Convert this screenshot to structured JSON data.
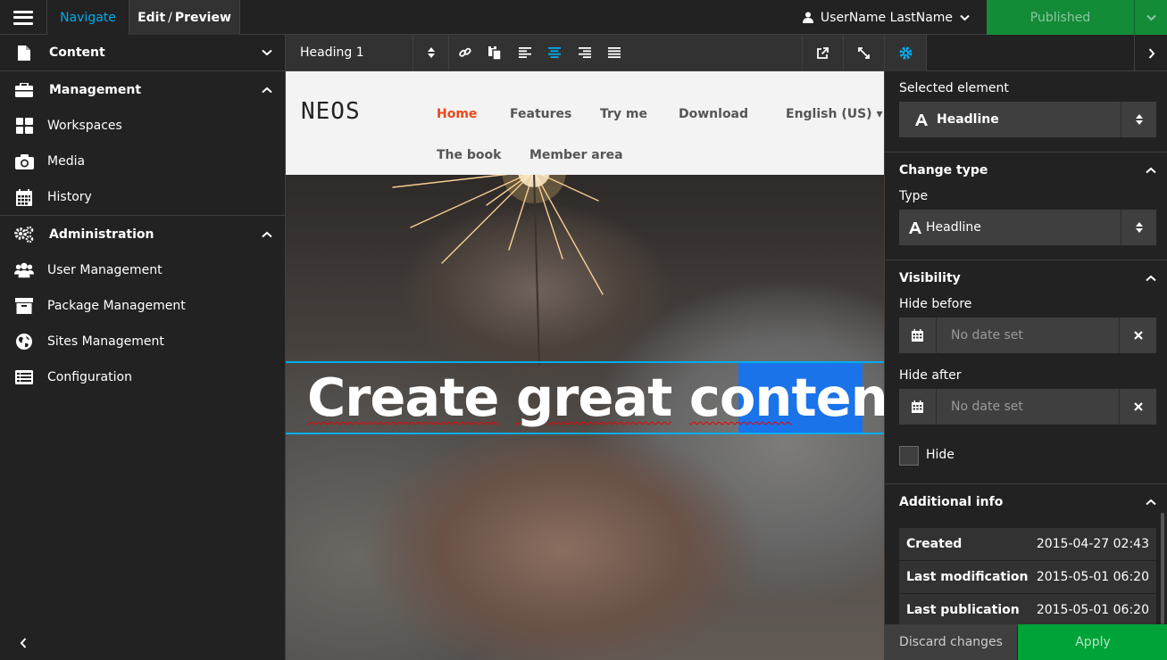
{
  "topbar": {
    "navigate_label": "Navigate",
    "edit_label": "Edit",
    "slash": "/",
    "preview_label": "Preview",
    "user_name": "UserName LastName",
    "publish_label": "Published"
  },
  "sidebar": {
    "content_label": "Content",
    "management_label": "Management",
    "management_items": [
      {
        "label": "Workspaces",
        "icon": "workspaces-icon"
      },
      {
        "label": "Media",
        "icon": "camera-icon"
      },
      {
        "label": "History",
        "icon": "calendar-icon"
      }
    ],
    "administration_label": "Administration",
    "administration_items": [
      {
        "label": "User Management",
        "icon": "users-icon"
      },
      {
        "label": "Package Management",
        "icon": "archive-icon"
      },
      {
        "label": "Sites Management",
        "icon": "globe-icon"
      },
      {
        "label": "Configuration",
        "icon": "list-icon"
      }
    ]
  },
  "toolbar": {
    "style_value": "Heading 1"
  },
  "site": {
    "logo": "NEOS",
    "nav": [
      "Home",
      "Features",
      "Try me",
      "Download",
      "English (US) ▾",
      "The book",
      "Member area"
    ],
    "active_color": "#e84a1b",
    "headline_words": [
      "Create",
      "great",
      "con",
      "tent."
    ]
  },
  "inspector": {
    "selected_element_label": "Selected element",
    "selected_element_value": "Headline",
    "change_type_label": "Change type",
    "type_label": "Type",
    "type_value": "Headline",
    "visibility_label": "Visibility",
    "hide_before_label": "Hide before",
    "hide_after_label": "Hide after",
    "date_placeholder": "No date set",
    "hide_label": "Hide",
    "additional_info_label": "Additional info",
    "info": [
      {
        "key": "Created",
        "value": "2015-04-27 02:43"
      },
      {
        "key": "Last modification",
        "value": "2015-05-01 06:20"
      },
      {
        "key": "Last publication",
        "value": "2015-05-01 06:20"
      }
    ],
    "discard_label": "Discard changes",
    "apply_label": "Apply"
  },
  "colors": {
    "accent": "#00adee",
    "publish_green": "#138b37",
    "apply_green": "#00a338",
    "selection_blue": "#1a73e8"
  }
}
